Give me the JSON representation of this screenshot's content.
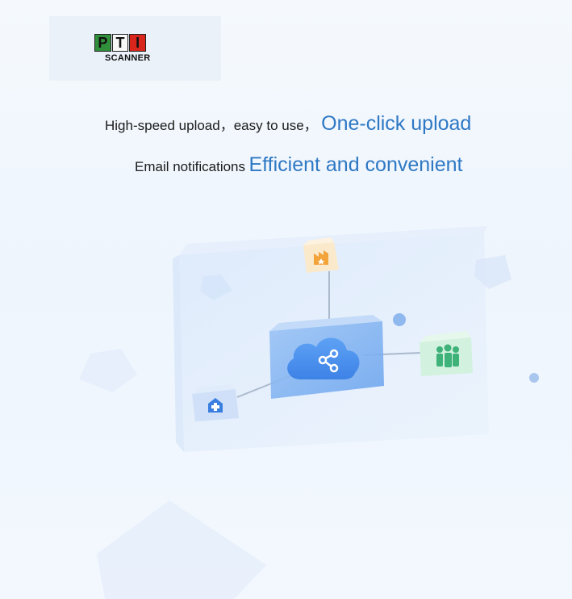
{
  "logo": {
    "letters": [
      "P",
      "T",
      "I"
    ],
    "subtitle": "SCANNER",
    "colors": [
      "#2f8f3a",
      "#f7f7f7",
      "#d9261c"
    ]
  },
  "headline": {
    "line1_plain": "High-speed upload，easy to use，",
    "line1_accent": "One-click upload",
    "line2_plain": "Email notifications",
    "line2_accent": "Efficient and convenient"
  },
  "illustration": {
    "center_icon": "cloud-share-icon",
    "nodes": [
      "factory-icon",
      "people-group-icon",
      "hospital-icon"
    ]
  },
  "colors": {
    "accent": "#2e78c4",
    "text": "#1b1b1b",
    "background": "#f3f8fe"
  }
}
